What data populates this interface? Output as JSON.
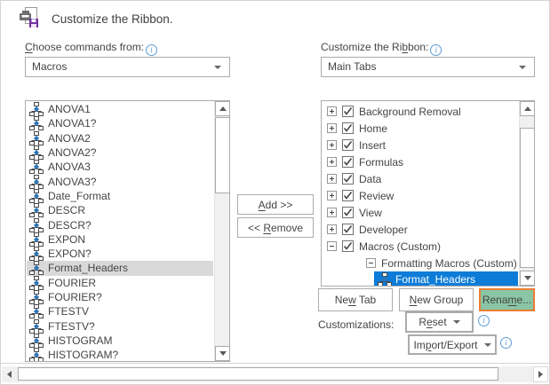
{
  "header": {
    "title": "Customize the Ribbon."
  },
  "choose_commands": {
    "label": {
      "text": "Choose commands from:",
      "u": 0
    },
    "dropdown_value": "Macros"
  },
  "customize_ribbon": {
    "label": {
      "text": "Customize the Ribbon:",
      "u": 16
    },
    "dropdown_value": "Main Tabs"
  },
  "commands_list": {
    "items": [
      "ANOVA1",
      "ANOVA1?",
      "ANOVA2",
      "ANOVA2?",
      "ANOVA3",
      "ANOVA3?",
      "Date_Format",
      "DESCR",
      "DESCR?",
      "EXPON",
      "EXPON?",
      "Format_Headers",
      "FOURIER",
      "FOURIER?",
      "FTESTV",
      "FTESTV?",
      "HISTOGRAM",
      "HISTOGRAM?"
    ],
    "selected_index": 11
  },
  "transfer_buttons": {
    "add": {
      "text": "Add >>",
      "u": 0
    },
    "remove": {
      "text": "<< Remove",
      "u": 3
    }
  },
  "ribbon_tree": {
    "items": [
      {
        "label": "Background Removal",
        "level": 0,
        "expander": "plus",
        "checked": true
      },
      {
        "label": "Home",
        "level": 0,
        "expander": "plus",
        "checked": true
      },
      {
        "label": "Insert",
        "level": 0,
        "expander": "plus",
        "checked": true
      },
      {
        "label": "Formulas",
        "level": 0,
        "expander": "plus",
        "checked": true
      },
      {
        "label": "Data",
        "level": 0,
        "expander": "plus",
        "checked": true
      },
      {
        "label": "Review",
        "level": 0,
        "expander": "plus",
        "checked": true
      },
      {
        "label": "View",
        "level": 0,
        "expander": "plus",
        "checked": true
      },
      {
        "label": "Developer",
        "level": 0,
        "expander": "plus",
        "checked": true
      },
      {
        "label": "Macros (Custom)",
        "level": 0,
        "expander": "minus",
        "checked": true
      },
      {
        "label": "Formatting Macros (Custom)",
        "level": 1,
        "expander": "minus"
      },
      {
        "label": "Format_Headers",
        "level": 2,
        "icon": "macro-icon",
        "selected": true
      }
    ]
  },
  "tab_buttons": {
    "new_tab": {
      "text": "New Tab",
      "u": 2
    },
    "new_group": {
      "text": "New Group",
      "u": 0
    },
    "rename": {
      "text": "Rename...",
      "u": 4
    }
  },
  "customizations": {
    "label": "Customizations:",
    "reset": {
      "text": "Reset",
      "u": 1
    },
    "import_export": {
      "text": "Import/Export",
      "u": 2
    }
  },
  "colors": {
    "selection_blue": "#0c7cd8",
    "selection_gray": "#d9d9d9",
    "rename_highlight_fill": "#8ac5a5",
    "rename_highlight_border": "#ed7d31",
    "info_blue": "#5b9bd5",
    "macro_icon_blue": "#2e75b6",
    "title_icon_purple": "#7030a0"
  }
}
